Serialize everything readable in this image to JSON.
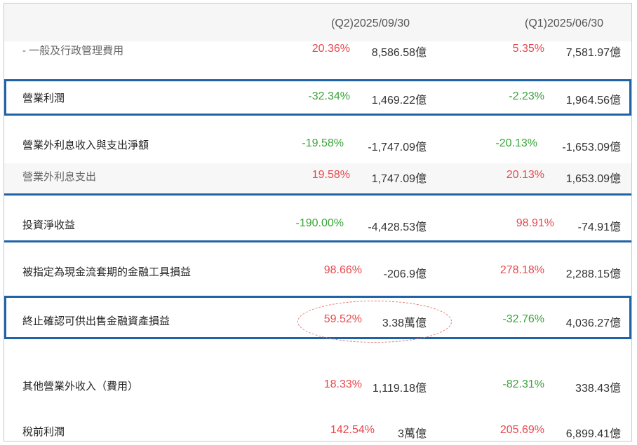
{
  "colors": {
    "red": "#e8484d",
    "green": "#3aa33a",
    "blue": "#1f63a6"
  },
  "header": {
    "col1": "(Q2)2025/09/30",
    "col2": "(Q1)2025/06/30"
  },
  "rows": [
    {
      "label": "-   一般及行政管理費用",
      "p1": "20.36%",
      "v1": "8,586.58億",
      "p2": "5.35%",
      "v2": "7,581.97億",
      "c1": "red",
      "c2": "red"
    },
    {
      "label": "營業利潤",
      "p1": "-32.34%",
      "v1": "1,469.22億",
      "p2": "-2.23%",
      "v2": "1,964.56億",
      "c1": "green",
      "c2": "green"
    },
    {
      "label": "營業外利息收入與支出淨額",
      "p1": "-19.58%",
      "v1": "-1,747.09億",
      "p2": "-20.13%",
      "v2": "-1,653.09億",
      "c1": "green",
      "c2": "green"
    },
    {
      "label": "營業外利息支出",
      "p1": "19.58%",
      "v1": "1,747.09億",
      "p2": "20.13%",
      "v2": "1,653.09億",
      "c1": "red",
      "c2": "red"
    },
    {
      "label": "投資淨收益",
      "p1": "-190.00%",
      "v1": "-4,428.53億",
      "p2": "98.91%",
      "v2": "-74.91億",
      "c1": "green",
      "c2": "red"
    },
    {
      "label": "被指定為現金流套期的金融工具損益",
      "p1": "98.66%",
      "v1": "-206.9億",
      "p2": "278.18%",
      "v2": "2,288.15億",
      "c1": "red",
      "c2": "red"
    },
    {
      "label": "終止確認可供出售金融資產損益",
      "p1": "59.52%",
      "v1": "3.38萬億",
      "p2": "-32.76%",
      "v2": "4,036.27億",
      "c1": "red",
      "c2": "green"
    },
    {
      "label": "其他營業外收入（費用）",
      "p1": "18.33%",
      "v1": "1,119.18億",
      "p2": "-82.31%",
      "v2": "338.43億",
      "c1": "red",
      "c2": "green"
    },
    {
      "label": "稅前利潤",
      "p1": "142.54%",
      "v1": "3萬億",
      "p2": "205.69%",
      "v2": "6,899.41億",
      "c1": "red",
      "c2": "red"
    }
  ]
}
